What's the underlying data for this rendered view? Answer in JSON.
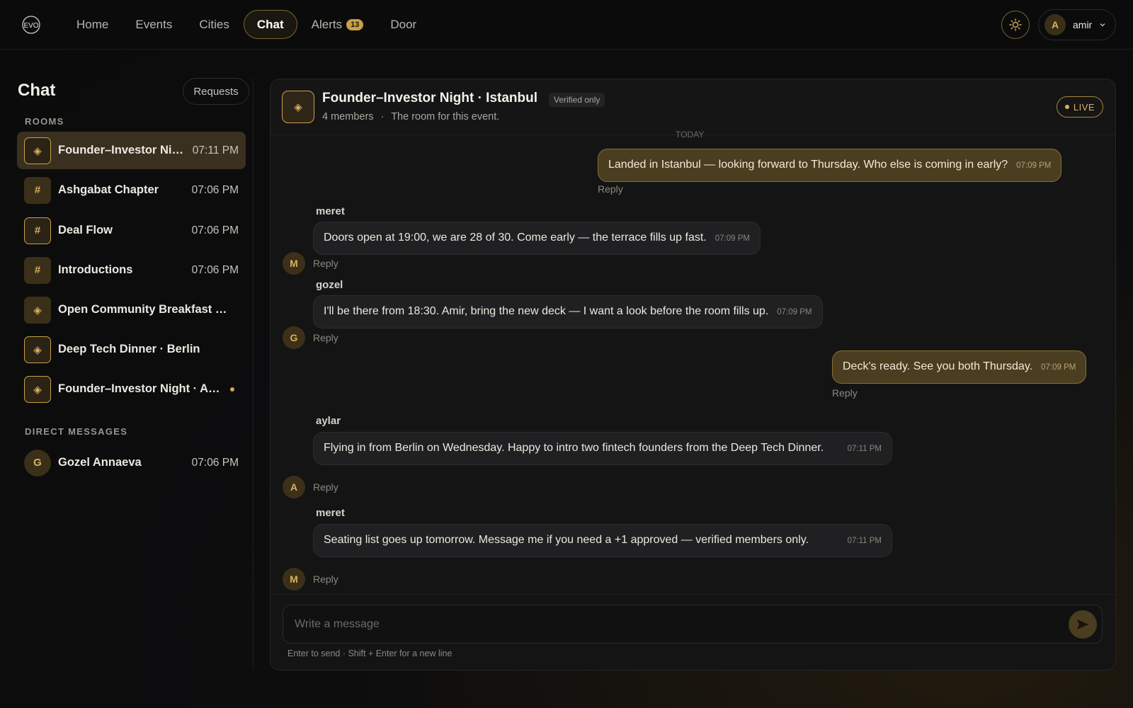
{
  "nav": {
    "logo_text": "EVO",
    "items": [
      {
        "label": "Home"
      },
      {
        "label": "Events"
      },
      {
        "label": "Cities"
      },
      {
        "label": "Chat",
        "active": true
      },
      {
        "label": "Alerts",
        "badge": "13"
      },
      {
        "label": "Door"
      }
    ],
    "theme_icon": "sun-icon",
    "user": {
      "initial": "A",
      "name": "amir"
    }
  },
  "sidebar": {
    "title": "Chat",
    "requests_label": "Requests",
    "rooms_label": "ROOMS",
    "rooms": [
      {
        "name": "Founder–Investor Night · Istanbul",
        "time": "07:11 PM",
        "icon": "diamond-icon",
        "active": true
      },
      {
        "name": "Ashgabat Chapter",
        "time": "07:06 PM",
        "icon": "hash-icon"
      },
      {
        "name": "Deal Flow",
        "time": "07:06 PM",
        "icon": "hash-icon"
      },
      {
        "name": "Introductions",
        "time": "07:06 PM",
        "icon": "hash-icon"
      },
      {
        "name": "Open Community Breakfast …",
        "time": "",
        "icon": "diamond-icon"
      },
      {
        "name": "Deep Tech Dinner · Berlin",
        "time": "",
        "icon": "diamond-icon"
      },
      {
        "name": "Founder–Investor Night · A…",
        "time": "",
        "icon": "diamond-icon",
        "unread": true
      }
    ],
    "dm_label": "DIRECT MESSAGES",
    "dms": [
      {
        "initial": "G",
        "name": "Gozel Annaeva",
        "time": "07:06 PM"
      }
    ]
  },
  "chat": {
    "title": "Founder–Investor Night · Istanbul",
    "verified": "Verified only",
    "members": "4 members",
    "subtitle": "The room for this event.",
    "live": "LIVE",
    "cut_text": "TODAY",
    "reply_label": "Reply",
    "messages": [
      {
        "mine": true,
        "text": "Landed in Istanbul — looking forward to Thursday. Who else is coming in early?",
        "time": "07:09 PM"
      },
      {
        "sender": "meret",
        "initial": "M",
        "text": "Doors open at 19:00, we are 28 of 30. Come early — the terrace fills up fast.",
        "time": "07:09 PM"
      },
      {
        "sender": "gozel",
        "initial": "G",
        "text": "I'll be there from 18:30. Amir, bring the new deck — I want a look before the room fills up.",
        "time": "07:09 PM"
      },
      {
        "mine": true,
        "text": "Deck's ready. See you both Thursday.",
        "time": "07:09 PM"
      },
      {
        "sender": "aylar",
        "initial": "A",
        "text": "Flying in from Berlin on Wednesday. Happy to intro two fintech founders from the Deep Tech Dinner.",
        "time": "07:11 PM"
      },
      {
        "sender": "meret",
        "initial": "M",
        "text": "Seating list goes up tomorrow. Message me if you need a +1 approved — verified members only.",
        "time": "07:11 PM"
      }
    ],
    "composer": {
      "placeholder": "Write a message",
      "hint": "Enter to send · Shift + Enter for a new line"
    }
  }
}
